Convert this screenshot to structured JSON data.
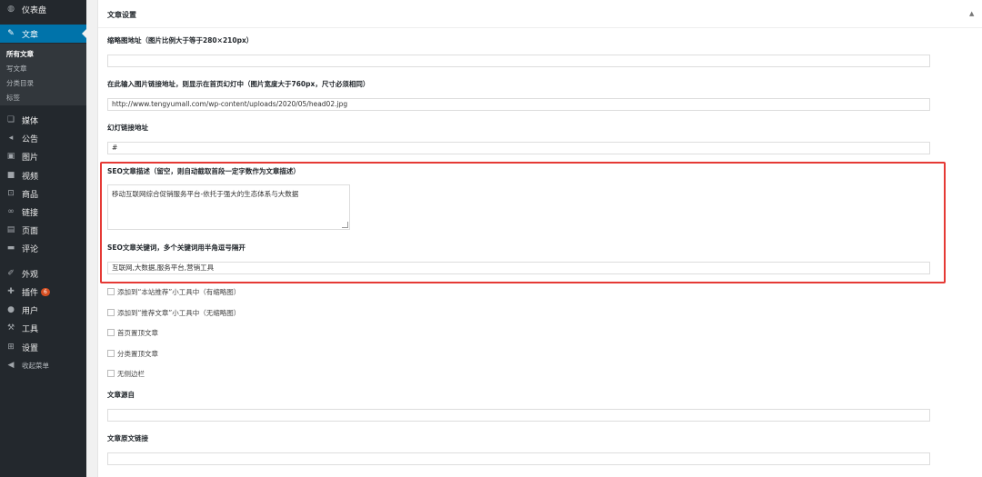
{
  "sidebar": {
    "items": [
      {
        "label": "仪表盘",
        "icon": "dashboard-icon",
        "glyph": "◍"
      },
      {
        "label": "文章",
        "icon": "pin-icon",
        "glyph": "✎"
      },
      {
        "label": "媒体",
        "icon": "media-icon",
        "glyph": "❏"
      },
      {
        "label": "公告",
        "icon": "megaphone-icon",
        "glyph": "◂"
      },
      {
        "label": "图片",
        "icon": "image-icon",
        "glyph": "▣"
      },
      {
        "label": "视频",
        "icon": "video-icon",
        "glyph": "■"
      },
      {
        "label": "商品",
        "icon": "cart-icon",
        "glyph": "⊡"
      },
      {
        "label": "链接",
        "icon": "link-icon",
        "glyph": "∞"
      },
      {
        "label": "页面",
        "icon": "page-icon",
        "glyph": "▤"
      },
      {
        "label": "评论",
        "icon": "comment-icon",
        "glyph": "▬"
      },
      {
        "label": "外观",
        "icon": "brush-icon",
        "glyph": "✐"
      },
      {
        "label": "插件",
        "icon": "plugin-icon",
        "glyph": "✚"
      },
      {
        "label": "用户",
        "icon": "user-icon",
        "glyph": "●"
      },
      {
        "label": "工具",
        "icon": "wrench-icon",
        "glyph": "⚒"
      },
      {
        "label": "设置",
        "icon": "settings-icon",
        "glyph": "⊞"
      },
      {
        "label": "收起菜单",
        "icon": "collapse-icon",
        "glyph": "◀"
      }
    ],
    "submenu": [
      "所有文章",
      "写文章",
      "分类目录",
      "标签"
    ],
    "plugin_badge": "6"
  },
  "box": {
    "title": "文章设置",
    "toggle": "▲"
  },
  "fields": {
    "thumb_label": "缩略图地址（图片比例大于等于280×210px）",
    "thumb_value": "",
    "slide_label": "在此输入图片链接地址，则显示在首页幻灯中（图片宽度大于760px，尺寸必须相同）",
    "slide_value": "http://www.tengyumall.com/wp-content/uploads/2020/05/head02.jpg",
    "slide_link_label": "幻灯链接地址",
    "slide_link_value": "#",
    "seo_desc_label": "SEO文章描述（留空，则自动截取首段一定字数作为文章描述）",
    "seo_desc_value": "移动互联网综合促销服务平台-依托于强大的生态体系与大数据",
    "seo_kw_label": "SEO文章关键词，多个关键词用半角逗号隔开",
    "seo_kw_value": "互联网,大数据,服务平台,营销工具",
    "source_label": "文章源自",
    "source_value": "",
    "source_link_label": "文章原文链接",
    "source_link_value": ""
  },
  "checkboxes": [
    "添加到“本站推荐”小工具中（有缩略图）",
    "添加到“推荐文章”小工具中（无缩略图）",
    "首页置顶文章",
    "分类置顶文章",
    "无侧边栏"
  ],
  "colors": {
    "sidebar_bg": "#23282d",
    "active": "#0073aa",
    "highlight": "#e53935"
  }
}
